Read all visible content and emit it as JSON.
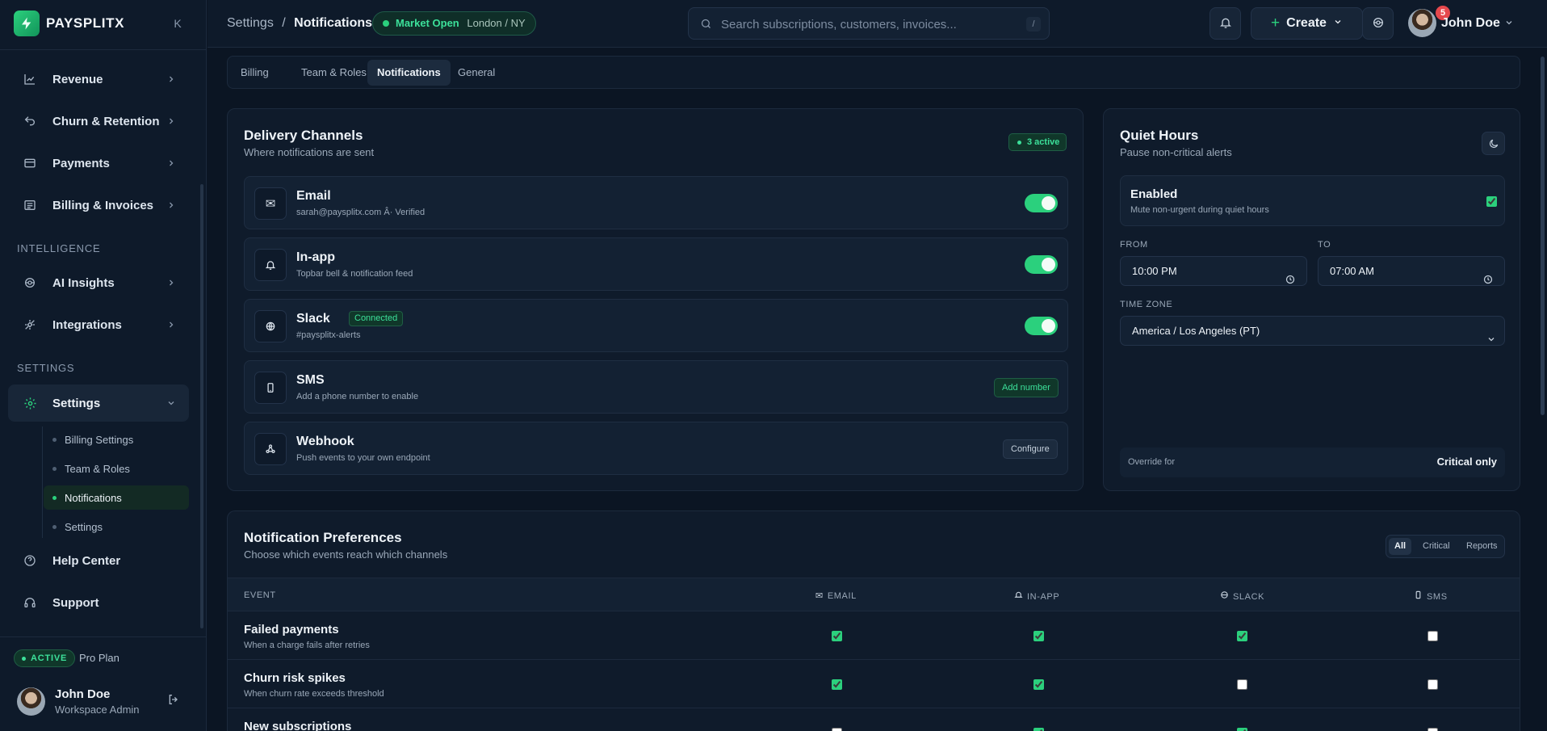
{
  "brand": {
    "name": "PAYSPLITX",
    "collapse": "K"
  },
  "sidebar": {
    "items": [
      {
        "label": "Revenue",
        "icon": "chart-line-icon"
      },
      {
        "label": "Churn & Retention",
        "icon": "undo-icon"
      },
      {
        "label": "Payments",
        "icon": "credit-card-icon"
      },
      {
        "label": "Billing & Invoices",
        "icon": "receipt-icon"
      }
    ],
    "intelligence_label": "INTELLIGENCE",
    "intel_items": [
      {
        "label": "AI Insights",
        "icon": "brain-icon"
      },
      {
        "label": "Integrations",
        "icon": "plug-icon"
      }
    ],
    "settings_label": "SETTINGS",
    "settings_item": {
      "label": "Settings",
      "icon": "gear-icon"
    },
    "sub_items": [
      "Billing Settings",
      "Team & Roles",
      "Notifications",
      "Settings"
    ],
    "bottom_items": [
      {
        "label": "Help Center",
        "icon": "help-circle-icon"
      },
      {
        "label": "Support",
        "icon": "headset-icon"
      }
    ],
    "footer": {
      "status": "ACTIVE",
      "plan": "Pro Plan",
      "name": "John Doe",
      "role": "Workspace Admin"
    }
  },
  "topbar": {
    "breadcrumb_parent": "Settings",
    "breadcrumb_sep": "/",
    "breadcrumb_current": "Notifications",
    "market_status": "Market Open",
    "market_location": "London / NY",
    "search_placeholder": "Search subscriptions, customers, invoices...",
    "search_kbd": "/",
    "notification_count": "5",
    "create_label": "Create",
    "user_name": "John Doe"
  },
  "tabs": [
    "Billing",
    "Team & Roles",
    "Notifications",
    "General"
  ],
  "delivery": {
    "title": "Delivery Channels",
    "subtitle": "Where notifications are sent",
    "active_count": "3 active",
    "channels": [
      {
        "name": "Email",
        "desc": "sarah@paysplitx.com Â· Verified",
        "icon": "mail-icon"
      },
      {
        "name": "In-app",
        "desc": "Topbar bell & notification feed",
        "icon": "bell-icon"
      },
      {
        "name": "Slack",
        "desc": "#paysplitx-alerts",
        "badge": "Connected",
        "icon": "slack-icon"
      },
      {
        "name": "SMS",
        "desc": "Add a phone number to enable",
        "action": "Add number",
        "icon": "phone-icon"
      },
      {
        "name": "Webhook",
        "desc": "Push events to your own endpoint",
        "action": "Configure",
        "icon": "webhook-icon"
      }
    ]
  },
  "quiet": {
    "title": "Quiet Hours",
    "subtitle": "Pause non-critical alerts",
    "enabled_title": "Enabled",
    "enabled_desc": "Mute non-urgent during quiet hours",
    "from_label": "FROM",
    "from_value": "10:00 PM",
    "to_label": "TO",
    "to_value": "07:00 AM",
    "tz_label": "TIME ZONE",
    "tz_value": "America / Los Angeles (PT)",
    "override_label": "Override for",
    "override_value": "Critical only"
  },
  "prefs": {
    "title": "Notification Preferences",
    "subtitle": "Choose which events reach which channels",
    "filters": [
      "All",
      "Critical",
      "Reports"
    ],
    "columns": {
      "event": "EVENT",
      "email": "EMAIL",
      "inapp": "IN-APP",
      "slack": "SLACK",
      "sms": "SMS"
    },
    "rows": [
      {
        "event": "Failed payments",
        "desc": "When a charge fails after retries",
        "email": true,
        "inapp": true,
        "slack": true,
        "sms": false
      },
      {
        "event": "Churn risk spikes",
        "desc": "When churn rate exceeds threshold",
        "email": true,
        "inapp": true,
        "slack": false,
        "sms": false
      },
      {
        "event": "New subscriptions",
        "desc": "",
        "email": false,
        "inapp": true,
        "slack": true,
        "sms": false
      }
    ]
  }
}
